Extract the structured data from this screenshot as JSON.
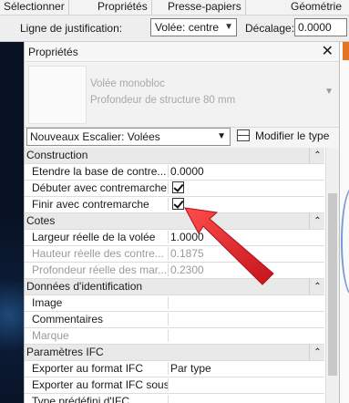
{
  "menu": [
    "Sélectionner",
    "Propriétés",
    "Presse-papiers",
    "Géométrie"
  ],
  "options": {
    "justification_label": "Ligne de justification:",
    "justification_value": "Volée: centre",
    "offset_label": "Décalage:",
    "offset_value": "0.0000"
  },
  "panel": {
    "title": "Propriétés",
    "type_family": "Volée monobloc",
    "type_name": "Profondeur de structure 80 mm",
    "instance_filter": "Nouveaux Escalier: Volées",
    "edit_type_label": "Modifier le type"
  },
  "sections": [
    {
      "title": "Construction",
      "rows": [
        {
          "name": "Etendre la base de contre...",
          "value": "0.0000"
        },
        {
          "name": "Débuter avec contremarche",
          "checkbox": true
        },
        {
          "name": "Finir avec contremarche",
          "checkbox": true
        }
      ]
    },
    {
      "title": "Cotes",
      "rows": [
        {
          "name": "Largeur réelle de la volée",
          "value": "1.0000"
        },
        {
          "name": "Hauteur réelle des contre...",
          "value": "0.1875",
          "dim": true
        },
        {
          "name": "Profondeur réelle des mar...",
          "value": "0.2300",
          "dim": true
        }
      ]
    },
    {
      "title": "Données d'identification",
      "rows": [
        {
          "name": "Image",
          "value": ""
        },
        {
          "name": "Commentaires",
          "value": ""
        },
        {
          "name": "Marque",
          "value": "",
          "dim": true
        }
      ]
    },
    {
      "title": "Paramètres IFC",
      "rows": [
        {
          "name": "Exporter au format IFC",
          "value": "Par type"
        },
        {
          "name": "Exporter au format IFC sous",
          "value": ""
        },
        {
          "name": "Type prédéfini d'IFC",
          "value": ""
        }
      ]
    }
  ],
  "icons": {
    "close": "close-icon",
    "collapse": "chevron-up-icon",
    "edit_type": "edit-type-icon",
    "annotation": "red-arrow-annotation"
  },
  "colors": {
    "annotation_arrow": "#e8212a",
    "accent_tab": "#e57422"
  }
}
